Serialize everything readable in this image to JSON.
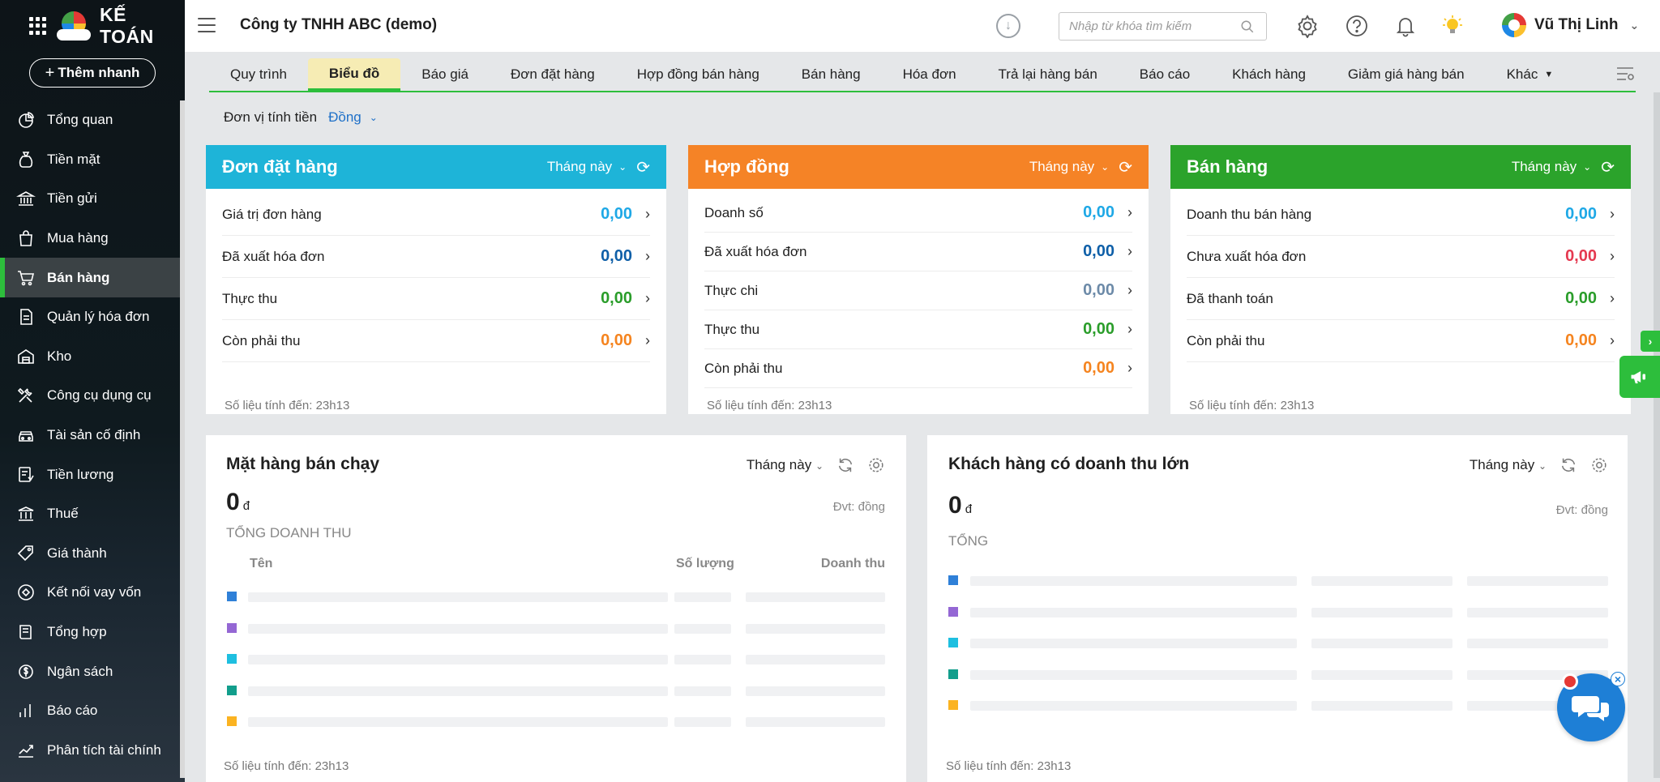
{
  "app": {
    "logo_text": "KẾ TOÁN",
    "quick_add": "Thêm nhanh",
    "company": "Công ty TNHH ABC (demo)",
    "search_placeholder": "Nhập từ khóa tìm kiếm",
    "user_name": "Vũ Thị Linh"
  },
  "sidebar": {
    "items": [
      {
        "label": "Tổng quan",
        "icon": "chart-pie-icon"
      },
      {
        "label": "Tiền mặt",
        "icon": "money-bag-icon"
      },
      {
        "label": "Tiền gửi",
        "icon": "bank-icon"
      },
      {
        "label": "Mua hàng",
        "icon": "shopping-bag-icon"
      },
      {
        "label": "Bán hàng",
        "icon": "cart-icon"
      },
      {
        "label": "Quản lý hóa đơn",
        "icon": "invoice-icon"
      },
      {
        "label": "Kho",
        "icon": "warehouse-icon"
      },
      {
        "label": "Công cụ dụng cụ",
        "icon": "tools-icon"
      },
      {
        "label": "Tài sản cố định",
        "icon": "car-icon"
      },
      {
        "label": "Tiền lương",
        "icon": "payroll-icon"
      },
      {
        "label": "Thuế",
        "icon": "tax-building-icon"
      },
      {
        "label": "Giá thành",
        "icon": "price-tag-icon"
      },
      {
        "label": "Kết nối vay vốn",
        "icon": "loan-link-icon"
      },
      {
        "label": "Tổng hợp",
        "icon": "book-icon"
      },
      {
        "label": "Ngân sách",
        "icon": "budget-icon"
      },
      {
        "label": "Báo cáo",
        "icon": "bar-chart-icon"
      },
      {
        "label": "Phân tích tài chính",
        "icon": "line-chart-icon"
      }
    ],
    "active_index": 4
  },
  "tabs": [
    "Quy trình",
    "Biểu đồ",
    "Báo giá",
    "Đơn đặt hàng",
    "Hợp đồng bán hàng",
    "Bán hàng",
    "Hóa đơn",
    "Trả lại hàng bán",
    "Báo cáo",
    "Khách hàng",
    "Giảm giá hàng bán",
    "Khác"
  ],
  "active_tab": "Biểu đồ",
  "unit": {
    "label": "Đơn vị tính tiền",
    "value": "Đồng"
  },
  "cards": [
    {
      "title": "Đơn đặt hàng",
      "period": "Tháng này",
      "color": "#1eb4d8",
      "rows": [
        {
          "label": "Giá trị đơn hàng",
          "value": "0,00",
          "color": "#1ea8e6"
        },
        {
          "label": "Đã xuất hóa đơn",
          "value": "0,00",
          "color": "#0e5fa8"
        },
        {
          "label": "Thực thu",
          "value": "0,00",
          "color": "#2a9d2a"
        },
        {
          "label": "Còn phải thu",
          "value": "0,00",
          "color": "#f5841f"
        }
      ],
      "footer": "Số liệu tính đến: 23h13"
    },
    {
      "title": "Hợp đồng",
      "period": "Tháng này",
      "color": "#f58326",
      "rows": [
        {
          "label": "Doanh số",
          "value": "0,00",
          "color": "#1ea8e6"
        },
        {
          "label": "Đã xuất hóa đơn",
          "value": "0,00",
          "color": "#0e5fa8"
        },
        {
          "label": "Thực chi",
          "value": "0,00",
          "color": "#6c8aa8"
        },
        {
          "label": "Thực thu",
          "value": "0,00",
          "color": "#2a9d2a"
        },
        {
          "label": "Còn phải thu",
          "value": "0,00",
          "color": "#f5841f"
        }
      ],
      "footer": "Số liệu tính đến: 23h13"
    },
    {
      "title": "Bán hàng",
      "period": "Tháng này",
      "color": "#2ba32b",
      "rows": [
        {
          "label": "Doanh thu bán hàng",
          "value": "0,00",
          "color": "#1ea8e6"
        },
        {
          "label": "Chưa xuất hóa đơn",
          "value": "0,00",
          "color": "#e53950"
        },
        {
          "label": "Đã thanh toán",
          "value": "0,00",
          "color": "#2a9d2a"
        },
        {
          "label": "Còn phải thu",
          "value": "0,00",
          "color": "#f5841f"
        }
      ],
      "footer": "Số liệu tính đến: 23h13"
    }
  ],
  "best_sellers": {
    "title": "Mặt hàng bán chạy",
    "period": "Tháng này",
    "total": "0",
    "currency": "đ",
    "unit": "Đvt: đồng",
    "caption": "TỔNG DOANH THU",
    "columns": [
      "Tên",
      "Số lượng",
      "Doanh thu"
    ],
    "swatches": [
      "#2f80d8",
      "#9467d4",
      "#1ebfe0",
      "#129e8c",
      "#fbb321"
    ],
    "footer": "Số liệu tính đến: 23h13"
  },
  "top_customers": {
    "title": "Khách hàng có doanh thu lớn",
    "period": "Tháng này",
    "total": "0",
    "currency": "đ",
    "unit": "Đvt: đồng",
    "caption": "TỔNG",
    "swatches": [
      "#2f80d8",
      "#9467d4",
      "#1ebfe0",
      "#129e8c",
      "#fbb321"
    ],
    "footer": "Số liệu tính đến: 23h13"
  }
}
